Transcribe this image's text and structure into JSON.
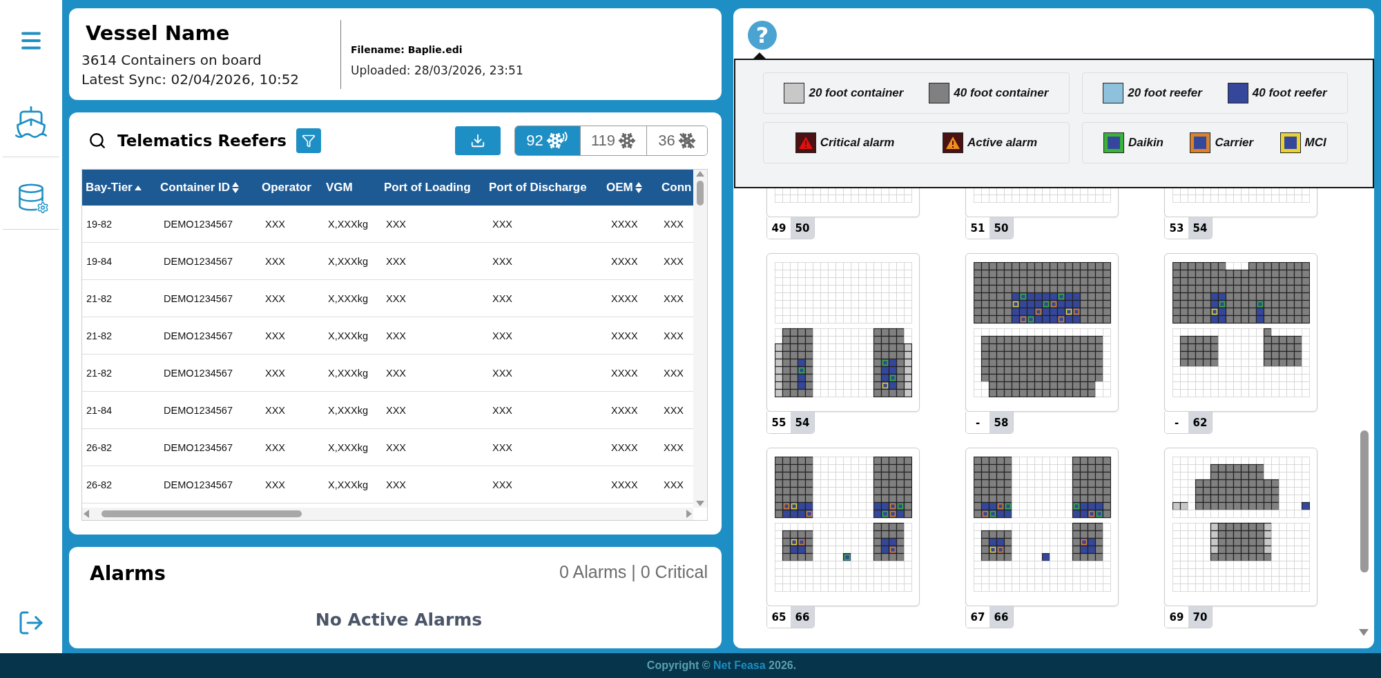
{
  "sidebar": {
    "items": [
      {
        "kind": "ship",
        "selected": false
      },
      {
        "kind": "database",
        "selected": false
      }
    ]
  },
  "vessel": {
    "name": "Vessel Name",
    "containers": "3614 Containers on board",
    "sync": "Latest Sync: 02/04/2026, 10:52",
    "filename": "Filename: Baplie.edi",
    "uploaded": "Uploaded: 28/03/2026, 23:51"
  },
  "reefers": {
    "title": "Telematics Reefers",
    "filters": [
      {
        "count": "92",
        "kind": "connected",
        "selected": true
      },
      {
        "count": "119",
        "kind": "all",
        "selected": false
      },
      {
        "count": "36",
        "kind": "disconnected",
        "selected": false
      }
    ],
    "table": {
      "columns": [
        {
          "label": "Bay-Tier",
          "sortable": true,
          "sorted": true
        },
        {
          "label": "Container ID",
          "sortable": true,
          "sorted": false
        },
        {
          "label": "Operator",
          "sortable": false,
          "sorted": false
        },
        {
          "label": "VGM",
          "sortable": false,
          "sorted": false
        },
        {
          "label": "Port of Loading",
          "sortable": false,
          "sorted": false
        },
        {
          "label": "Port of Discharge",
          "sortable": false,
          "sorted": false
        },
        {
          "label": "OEM",
          "sortable": true,
          "sorted": false
        },
        {
          "label": "Conn"
        }
      ],
      "rows": [
        [
          "19-82",
          "DEMO1234567",
          "XXX",
          "X,XXXkg",
          "XXX",
          "XXX",
          "XXXX",
          "XXX"
        ],
        [
          "19-84",
          "DEMO1234567",
          "XXX",
          "X,XXXkg",
          "XXX",
          "XXX",
          "XXXX",
          "XXX"
        ],
        [
          "21-82",
          "DEMO1234567",
          "XXX",
          "X,XXXkg",
          "XXX",
          "XXX",
          "XXXX",
          "XXX"
        ],
        [
          "21-82",
          "DEMO1234567",
          "XXX",
          "X,XXXkg",
          "XXX",
          "XXX",
          "XXXX",
          "XXX"
        ],
        [
          "21-82",
          "DEMO1234567",
          "XXX",
          "X,XXXkg",
          "XXX",
          "XXX",
          "XXXX",
          "XXX"
        ],
        [
          "21-84",
          "DEMO1234567",
          "XXX",
          "X,XXXkg",
          "XXX",
          "XXX",
          "XXXX",
          "XXX"
        ],
        [
          "26-82",
          "DEMO1234567",
          "XXX",
          "X,XXXkg",
          "XXX",
          "XXX",
          "XXXX",
          "XXX"
        ],
        [
          "26-82",
          "DEMO1234567",
          "XXX",
          "X,XXXkg",
          "XXX",
          "XXX",
          "XXXX",
          "XXX"
        ]
      ]
    }
  },
  "alarms": {
    "title": "Alarms",
    "summary": "0 Alarms | 0 Critical",
    "empty": "No Active Alarms"
  },
  "help": {
    "label": "?"
  },
  "legend": {
    "groups": [
      {
        "items": [
          {
            "label": "20 foot container",
            "kind": "box",
            "color": "#c8c8c8"
          },
          {
            "label": "40 foot container",
            "kind": "box",
            "color": "#808080"
          }
        ]
      },
      {
        "items": [
          {
            "label": "20 foot reefer",
            "kind": "box",
            "color": "#8ec1dc"
          },
          {
            "label": "40 foot reefer",
            "kind": "box",
            "color": "#35479a"
          }
        ]
      },
      {
        "items": [
          {
            "label": "Critical alarm",
            "kind": "alarm",
            "color": "#e01010"
          },
          {
            "label": "Active alarm",
            "kind": "alarm",
            "color": "#f0901a"
          }
        ]
      },
      {
        "items": [
          {
            "label": "Daikin",
            "kind": "oem",
            "color": "#3ab33a"
          },
          {
            "label": "Carrier",
            "kind": "oem",
            "color": "#d9822b"
          },
          {
            "label": "MCI",
            "kind": "oem",
            "color": "#e8d232"
          }
        ]
      }
    ]
  },
  "bays": [
    {
      "labels": [
        "49",
        "50"
      ]
    },
    {
      "labels": [
        "51",
        "50"
      ]
    },
    {
      "labels": [
        "53",
        "54"
      ]
    },
    {
      "labels": [
        "55",
        "54"
      ]
    },
    {
      "labels": [
        "-",
        "58"
      ]
    },
    {
      "labels": [
        "-",
        "62"
      ]
    },
    {
      "labels": [
        "65",
        "66"
      ]
    },
    {
      "labels": [
        "67",
        "66"
      ]
    },
    {
      "labels": [
        "69",
        "70"
      ]
    }
  ],
  "footer": {
    "before": "Copyright ©",
    "link": "Net Feasa",
    "after": "2026."
  }
}
